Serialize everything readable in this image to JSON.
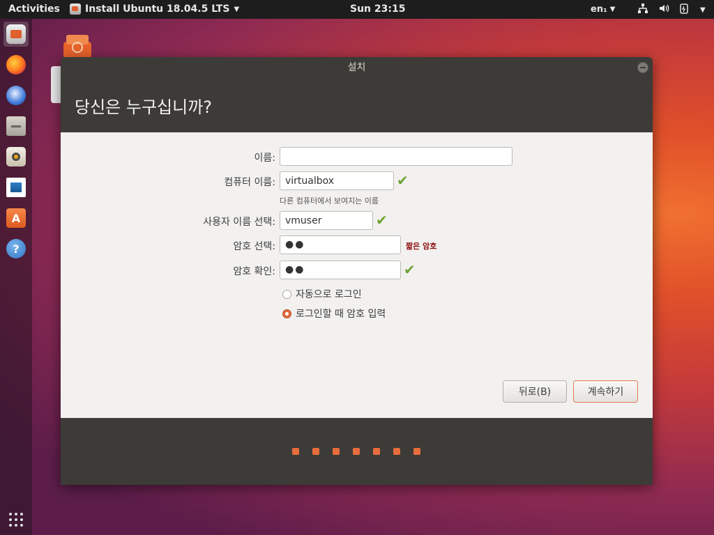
{
  "topbar": {
    "activities": "Activities",
    "app_name": "Install Ubuntu 18.04.5 LTS",
    "clock": "Sun 23:15",
    "lang": "en₁"
  },
  "dock": {
    "items": [
      "installer-icon",
      "firefox-icon",
      "thunderbird-icon",
      "files-icon",
      "rhythmbox-icon",
      "libreoffice-writer-icon",
      "software-center-icon",
      "help-icon"
    ]
  },
  "window": {
    "title": "설치",
    "heading": "당신은 누구십니까?"
  },
  "form": {
    "name_label": "이름:",
    "name_value": "",
    "computer_label": "컴퓨터 이름:",
    "computer_value": "virtualbox",
    "computer_hint": "다른 컴퓨터에서 보여지는 이름",
    "username_label": "사용자 이름 선택:",
    "username_value": "vmuser",
    "password_label": "암호 선택:",
    "password_value": "●●",
    "password_strength": "짧은 암호",
    "confirm_label": "암호 확인:",
    "confirm_value": "●●",
    "auto_login": "자동으로 로그인",
    "require_password": "로그인할 때 암호 입력",
    "selected_option": "require_password"
  },
  "buttons": {
    "back": "뒤로(B)",
    "continue": "계속하기"
  },
  "progress": {
    "steps": 7
  },
  "colors": {
    "accent": "#e86d3c",
    "check": "#6da330",
    "weak": "#8e1111",
    "window_bg": "#3c3b37"
  }
}
